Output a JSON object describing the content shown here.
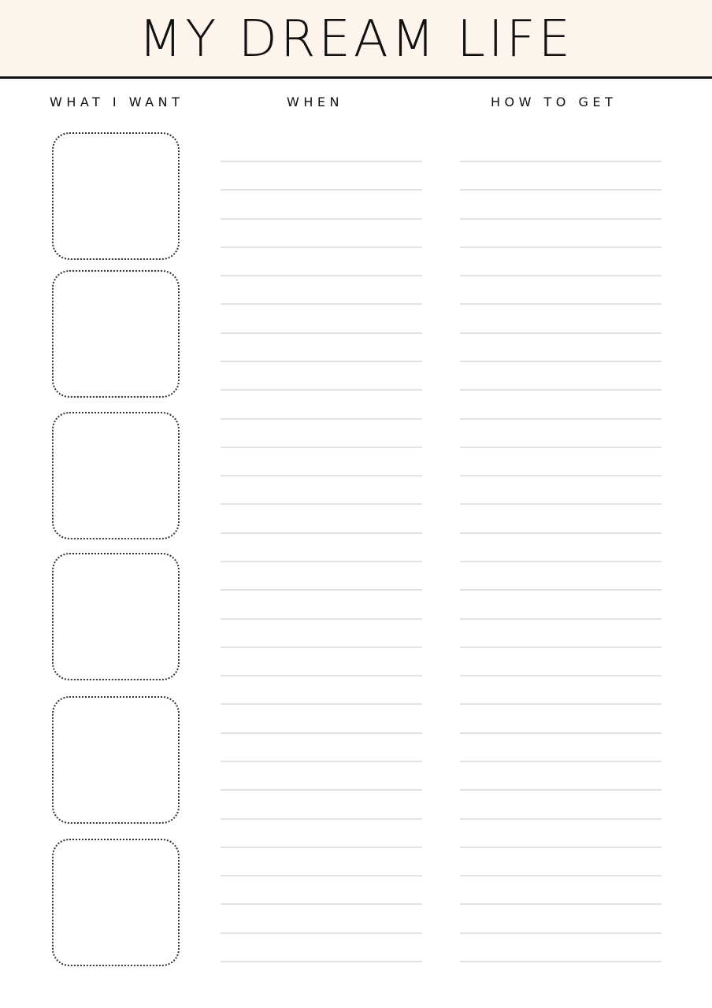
{
  "page": {
    "title": "MY DREAM LIFE",
    "colors": {
      "header_background": "#fdf5ec",
      "rule": "#111111",
      "writing_line": "#e2e2e2",
      "box_border": "#333333"
    }
  },
  "columns": [
    {
      "id": "want",
      "label": "WHAT I WANT",
      "kind": "picture-boxes",
      "count": 6
    },
    {
      "id": "when",
      "label": "WHEN",
      "kind": "writing-lines",
      "count": 29
    },
    {
      "id": "how",
      "label": "HOW TO GET",
      "kind": "writing-lines",
      "count": 29
    }
  ]
}
